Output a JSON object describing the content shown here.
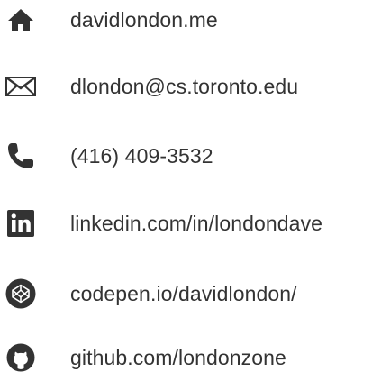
{
  "contacts": {
    "website": {
      "label": "davidlondon.me",
      "icon": "home-icon"
    },
    "email": {
      "label": "dlondon@cs.toronto.edu",
      "icon": "envelope-icon"
    },
    "phone": {
      "label": "(416) 409-3532",
      "icon": "phone-icon"
    },
    "linkedin": {
      "label": "linkedin.com/in/londondave",
      "icon": "linkedin-icon"
    },
    "codepen": {
      "label": "codepen.io/davidlondon/",
      "icon": "codepen-icon"
    },
    "github": {
      "label": "github.com/londonzone",
      "icon": "github-icon"
    }
  },
  "colors": {
    "icon": "#333333",
    "text": "#333333",
    "background": "#ffffff"
  }
}
